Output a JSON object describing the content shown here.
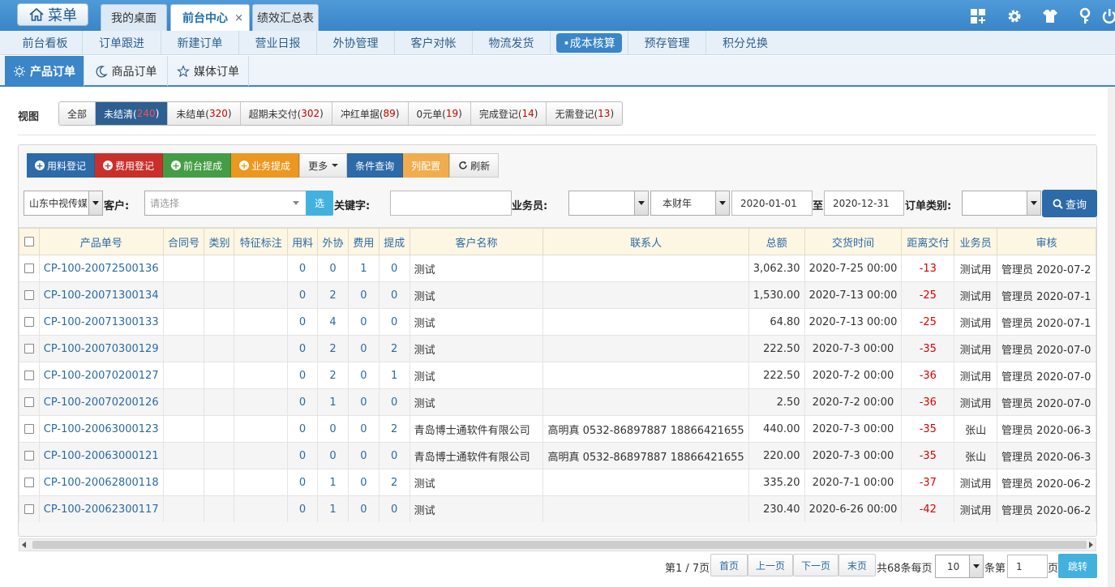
{
  "app": {
    "menu_label": "菜单",
    "tabs": [
      {
        "label": "我的桌面"
      },
      {
        "label": "前台中心",
        "close": "×"
      },
      {
        "label": "绩效汇总表"
      }
    ]
  },
  "nav": [
    "前台看板",
    "订单跟进",
    "新建订单",
    "营业日报",
    "外协管理",
    "客户对帐",
    "物流发货",
    "•成本核算",
    "预存管理",
    "积分兑换"
  ],
  "subtabs": [
    "产品订单",
    "商品订单",
    "媒体订单"
  ],
  "view": {
    "label": "视图",
    "filters": [
      {
        "name": "全部",
        "count": ""
      },
      {
        "name": "未结清(",
        "count": "240",
        "close": ")"
      },
      {
        "name": "未结单(",
        "count": "320",
        "close": ")"
      },
      {
        "name": "超期未交付(",
        "count": "302",
        "close": ")"
      },
      {
        "name": "冲红单据(",
        "count": "89",
        "close": ")"
      },
      {
        "name": "0元单(",
        "count": "19",
        "close": ")"
      },
      {
        "name": "完成登记(",
        "count": "14",
        "close": ")"
      },
      {
        "name": "无需登记(",
        "count": "13",
        "close": ")"
      }
    ]
  },
  "toolbar": {
    "material": "用料登记",
    "cost": "费用登记",
    "front_commission": "前台提成",
    "biz_commission": "业务提成",
    "more": "更多",
    "condition_query": "条件查询",
    "column_config": "列配置",
    "refresh": "刷新"
  },
  "search": {
    "company": "山东中视传媒",
    "customer_label": "客户:",
    "customer_placeholder": "请选择",
    "select_btn": "选",
    "keyword_label": "关键字:",
    "keyword_value": "",
    "salesman_label": "业务员:",
    "salesman_value": "",
    "period": "本财年",
    "date_from": "2020-01-01",
    "to_label": "至",
    "date_to": "2020-12-31",
    "order_type_label": "订单类别:",
    "order_type_value": "",
    "query_btn": "查询"
  },
  "table": {
    "headers": [
      "产品单号",
      "合同号",
      "类别",
      "特征标注",
      "用料",
      "外协",
      "费用",
      "提成",
      "客户名称",
      "联系人",
      "总额",
      "交货时间",
      "距离交付",
      "业务员",
      "审核"
    ],
    "rows": [
      {
        "no": "CP-100-20072500136",
        "contract": "",
        "type": "",
        "tag": "",
        "m": "0",
        "w": "0",
        "f": "1",
        "t": "0",
        "customer": "测试",
        "contact": "",
        "total": "3,062.30",
        "delivery": "2020-7-25 00:00",
        "days": "-13",
        "sales": "测试用",
        "audit": "管理员 2020-07-2"
      },
      {
        "no": "CP-100-20071300134",
        "contract": "",
        "type": "",
        "tag": "",
        "m": "0",
        "w": "2",
        "f": "0",
        "t": "0",
        "customer": "测试",
        "contact": "",
        "total": "1,530.00",
        "delivery": "2020-7-13 00:00",
        "days": "-25",
        "sales": "测试用",
        "audit": "管理员 2020-07-1"
      },
      {
        "no": "CP-100-20071300133",
        "contract": "",
        "type": "",
        "tag": "",
        "m": "0",
        "w": "4",
        "f": "0",
        "t": "0",
        "customer": "测试",
        "contact": "",
        "total": "64.80",
        "delivery": "2020-7-13 00:00",
        "days": "-25",
        "sales": "测试用",
        "audit": "管理员 2020-07-1"
      },
      {
        "no": "CP-100-20070300129",
        "contract": "",
        "type": "",
        "tag": "",
        "m": "0",
        "w": "2",
        "f": "0",
        "t": "2",
        "customer": "测试",
        "contact": "",
        "total": "222.50",
        "delivery": "2020-7-3 00:00",
        "days": "-35",
        "sales": "测试用",
        "audit": "管理员 2020-07-0"
      },
      {
        "no": "CP-100-20070200127",
        "contract": "",
        "type": "",
        "tag": "",
        "m": "0",
        "w": "2",
        "f": "0",
        "t": "1",
        "customer": "测试",
        "contact": "",
        "total": "222.50",
        "delivery": "2020-7-2 00:00",
        "days": "-36",
        "sales": "测试用",
        "audit": "管理员 2020-07-0"
      },
      {
        "no": "CP-100-20070200126",
        "contract": "",
        "type": "",
        "tag": "",
        "m": "0",
        "w": "1",
        "f": "0",
        "t": "0",
        "customer": "测试",
        "contact": "",
        "total": "2.50",
        "delivery": "2020-7-2 00:00",
        "days": "-36",
        "sales": "测试用",
        "audit": "管理员 2020-07-0"
      },
      {
        "no": "CP-100-20063000123",
        "contract": "",
        "type": "",
        "tag": "",
        "m": "0",
        "w": "0",
        "f": "0",
        "t": "2",
        "customer": "青岛博士通软件有限公司",
        "contact": "高明真 0532-86897887 18866421655",
        "total": "440.00",
        "delivery": "2020-7-3 00:00",
        "days": "-35",
        "sales": "张山",
        "audit": "管理员 2020-06-3"
      },
      {
        "no": "CP-100-20063000121",
        "contract": "",
        "type": "",
        "tag": "",
        "m": "0",
        "w": "0",
        "f": "0",
        "t": "0",
        "customer": "青岛博士通软件有限公司",
        "contact": "高明真 0532-86897887 18866421655",
        "total": "220.00",
        "delivery": "2020-7-3 00:00",
        "days": "-35",
        "sales": "张山",
        "audit": "管理员 2020-06-3"
      },
      {
        "no": "CP-100-20062800118",
        "contract": "",
        "type": "",
        "tag": "",
        "m": "0",
        "w": "1",
        "f": "0",
        "t": "2",
        "customer": "测试",
        "contact": "",
        "total": "335.20",
        "delivery": "2020-7-1 00:00",
        "days": "-37",
        "sales": "测试用",
        "audit": "管理员 2020-06-2"
      },
      {
        "no": "CP-100-20062300117",
        "contract": "",
        "type": "",
        "tag": "",
        "m": "0",
        "w": "1",
        "f": "0",
        "t": "0",
        "customer": "测试",
        "contact": "",
        "total": "230.40",
        "delivery": "2020-6-26 00:00",
        "days": "-42",
        "sales": "测试用",
        "audit": "管理员 2020-06-2"
      }
    ]
  },
  "pager": {
    "page_info": "第1 / 7页",
    "first": "首页",
    "prev": "上一页",
    "next": "下一页",
    "last": "末页",
    "total_per": "共68条每页",
    "per_page": "10",
    "item_label": "条第",
    "page_input": "1",
    "page_suffix": "页",
    "jump": "跳转"
  },
  "colors": {
    "primary": "#3a86c8",
    "danger": "#c9302c",
    "success": "#449d44",
    "warning": "#ec971f",
    "info": "#43b1de",
    "header_bg": "#fcf6e3"
  }
}
